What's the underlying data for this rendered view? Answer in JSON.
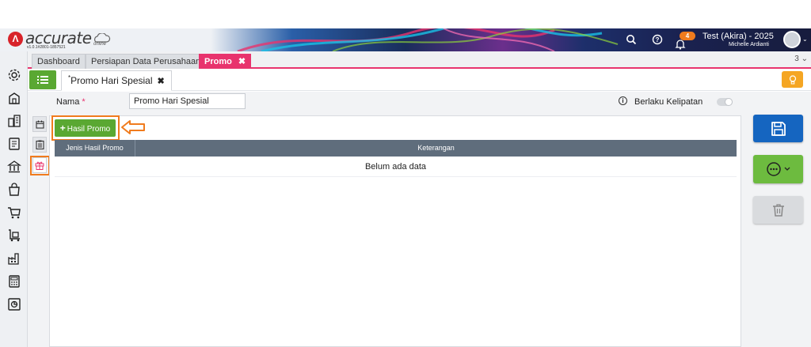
{
  "app": {
    "logo_text": "accurate",
    "logo_sub": "online",
    "version": "v1.0.1#2801-1857521",
    "notification_count": "4",
    "user_name": "Test (Akira) - 2025",
    "user_sub": "Michelle Ardianti"
  },
  "tabs": {
    "items": [
      {
        "label": "Dashboard"
      },
      {
        "label": "Persiapan Data Perusahaan"
      },
      {
        "label": "Promo",
        "close": "✖"
      }
    ],
    "count": "3 ⌄"
  },
  "subtab": {
    "star": "*",
    "label": "Promo Hari Spesial",
    "close": "✖"
  },
  "form": {
    "nama_label": "Nama",
    "required_mark": "*",
    "nama_value": "Promo Hari Spesial",
    "kelipatan_label": "Berlaku Kelipatan",
    "info_glyph": "i"
  },
  "panel": {
    "add_button_label": "Hasil Promo",
    "add_plus": "+",
    "columns": [
      "Jenis Hasil Promo",
      "Keterangan"
    ],
    "empty_text": "Belum ada data"
  },
  "colors": {
    "accent_pink": "#e8336d",
    "green": "#5aa832",
    "save_blue": "#1565c0",
    "highlight_orange": "#f07b1d",
    "table_header": "#5f6d7c"
  },
  "icons": {
    "sidebar": [
      "settings-icon",
      "building-icon",
      "city-icon",
      "ledger-icon",
      "bank-icon",
      "bag-icon",
      "cart-icon",
      "delivery-cart-icon",
      "factory-icon",
      "calculator-icon",
      "report-icon"
    ],
    "vertical_tabs": [
      "calendar-icon",
      "clipboard-icon",
      "gift-icon"
    ]
  }
}
